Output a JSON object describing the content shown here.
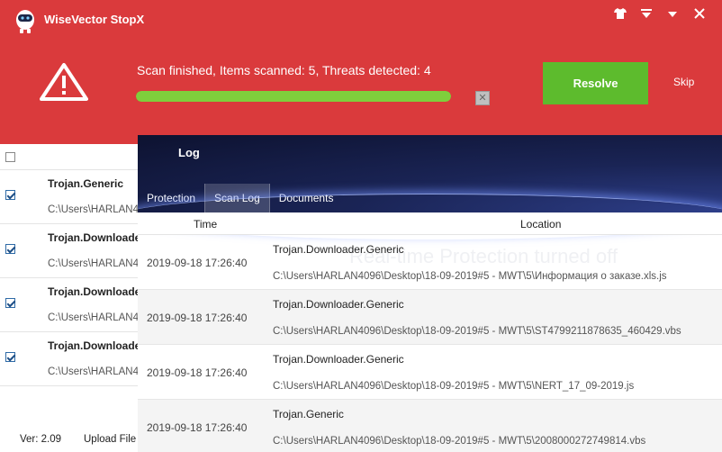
{
  "app": {
    "title": "WiseVector StopX"
  },
  "scan": {
    "status": "Scan finished, Items scanned: 5, Threats detected: 4",
    "progress_percent": 100,
    "resolve_label": "Resolve",
    "skip_label": "Skip"
  },
  "threat_list": {
    "items": [
      {
        "name": "Trojan.Generic",
        "path": "C:\\Users\\HARLAN4",
        "checked": true
      },
      {
        "name": "Trojan.Downloade",
        "path": "C:\\Users\\HARLAN4",
        "checked": true
      },
      {
        "name": "Trojan.Downloade",
        "path": "C:\\Users\\HARLAN4",
        "checked": true
      },
      {
        "name": "Trojan.Downloade",
        "path": "C:\\Users\\HARLAN4",
        "checked": true
      }
    ]
  },
  "footer": {
    "version": "Ver: 2.09",
    "upload_label": "Upload File"
  },
  "log": {
    "title": "Log",
    "tabs": [
      "Protection",
      "Scan Log",
      "Documents"
    ],
    "active_tab": "Scan Log",
    "columns": {
      "time": "Time",
      "location": "Location"
    },
    "rows": [
      {
        "time": "2019-09-18 17:26:40",
        "name": "Trojan.Downloader.Generic",
        "path": "C:\\Users\\HARLAN4096\\Desktop\\18-09-2019#5 - MWT\\5\\Информация о заказе.xls.js"
      },
      {
        "time": "2019-09-18 17:26:40",
        "name": "Trojan.Downloader.Generic",
        "path": "C:\\Users\\HARLAN4096\\Desktop\\18-09-2019#5 - MWT\\5\\ST4799211878635_460429.vbs"
      },
      {
        "time": "2019-09-18 17:26:40",
        "name": "Trojan.Downloader.Generic",
        "path": "C:\\Users\\HARLAN4096\\Desktop\\18-09-2019#5 - MWT\\5\\NERT_17_09-2019.js"
      },
      {
        "time": "2019-09-18 17:26:40",
        "name": "Trojan.Generic",
        "path": "C:\\Users\\HARLAN4096\\Desktop\\18-09-2019#5 - MWT\\5\\2008000272749814.vbs"
      }
    ],
    "background_text": "Real-time Protection turned off"
  },
  "colors": {
    "header": "#da3a3c",
    "resolve": "#5dbb2d",
    "progress": "#7fcf3c"
  },
  "icons": [
    "robot-logo-icon",
    "skin-icon",
    "menu-icon",
    "minimize-icon",
    "close-icon",
    "warning-icon",
    "cancel-icon",
    "checkbox-icon"
  ]
}
